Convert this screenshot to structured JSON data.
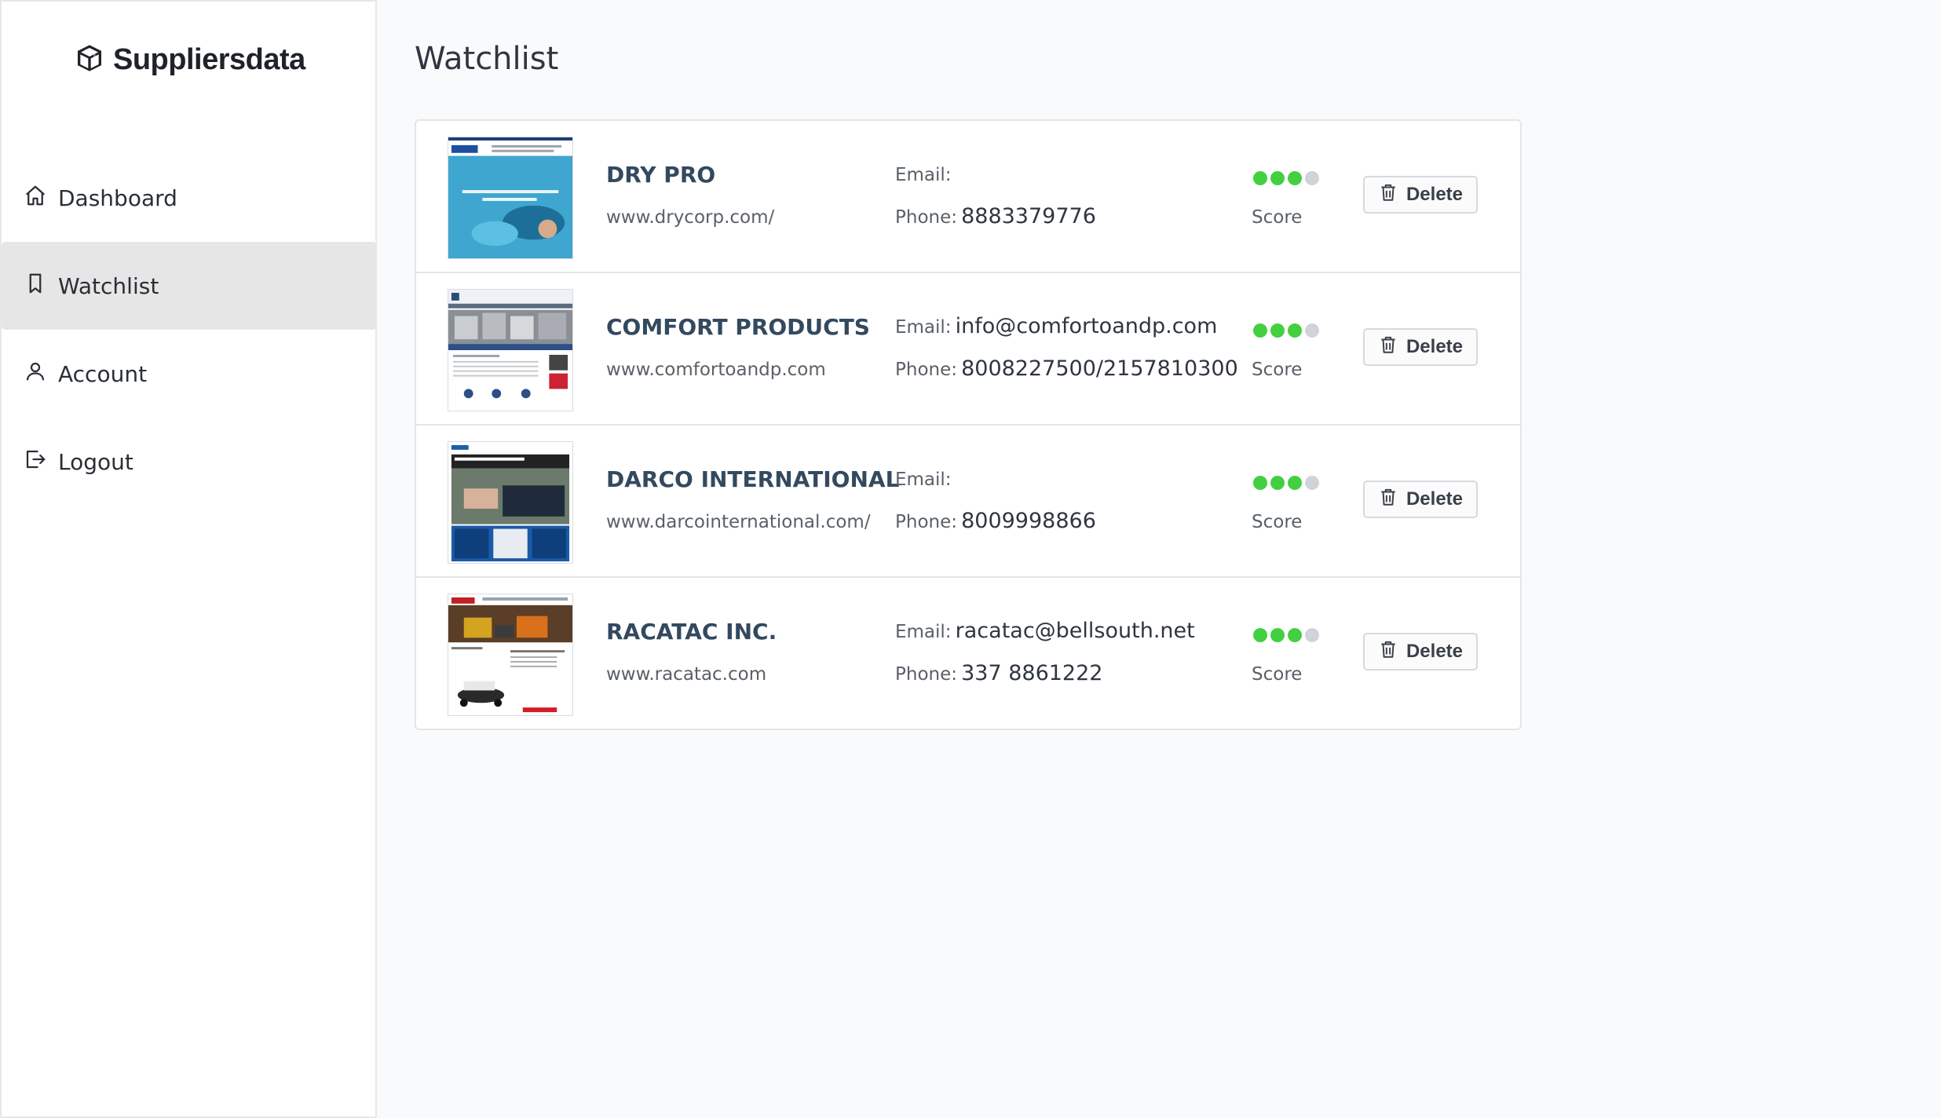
{
  "brand": {
    "name": "Suppliersdata",
    "icon": "cube-icon"
  },
  "nav": [
    {
      "label": "Dashboard",
      "icon": "home-icon",
      "active": false
    },
    {
      "label": "Watchlist",
      "icon": "bookmark-icon",
      "active": true
    },
    {
      "label": "Account",
      "icon": "user-icon",
      "active": false
    },
    {
      "label": "Logout",
      "icon": "logout-icon",
      "active": false
    }
  ],
  "page": {
    "title": "Watchlist"
  },
  "labels": {
    "email": "Email:",
    "phone": "Phone:",
    "score": "Score",
    "delete": "Delete"
  },
  "colors": {
    "score_on": "#43d040",
    "score_off": "#d0d3d8",
    "active_nav": "#e6e6e6"
  },
  "suppliers": [
    {
      "name": "DRY PRO",
      "url": "www.drycorp.com/",
      "email": "",
      "phone": "8883379776",
      "score": 3,
      "score_max": 4
    },
    {
      "name": "COMFORT PRODUCTS",
      "url": "www.comfortoandp.com",
      "email": "info@comfortoandp.com",
      "phone": "8008227500/2157810300",
      "score": 3,
      "score_max": 4
    },
    {
      "name": "DARCO INTERNATIONAL",
      "url": "www.darcointernational.com/",
      "email": "",
      "phone": "8009998866",
      "score": 3,
      "score_max": 4
    },
    {
      "name": "RACATAC INC.",
      "url": "www.racatac.com",
      "email": "racatac@bellsouth.net",
      "phone": "337 8861222",
      "score": 3,
      "score_max": 4
    }
  ]
}
